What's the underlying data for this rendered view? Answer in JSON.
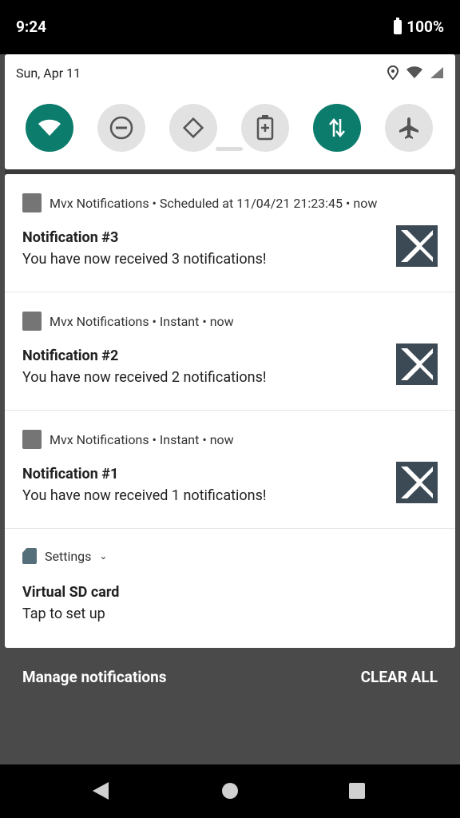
{
  "status_bar": {
    "time": "9:24",
    "battery": "100%"
  },
  "quick_settings": {
    "date": "Sun, Apr 11",
    "tiles": [
      {
        "name": "wifi",
        "active": true
      },
      {
        "name": "do-not-disturb",
        "active": false
      },
      {
        "name": "auto-rotate",
        "active": false
      },
      {
        "name": "battery-saver",
        "active": false
      },
      {
        "name": "mobile-data",
        "active": true
      },
      {
        "name": "airplane-mode",
        "active": false
      }
    ]
  },
  "notifications": [
    {
      "app": "Mvx Notifications",
      "meta": " • Scheduled at 11/04/21 21:23:45 • now",
      "title": "Notification #3",
      "text": "You have now received 3 notifications!"
    },
    {
      "app": "Mvx Notifications",
      "meta": " • Instant • now",
      "title": "Notification #2",
      "text": "You have now received 2 notifications!"
    },
    {
      "app": "Mvx Notifications",
      "meta": " • Instant • now",
      "title": "Notification #1",
      "text": "You have now received 1 notifications!"
    }
  ],
  "settings_notification": {
    "app": "Settings",
    "title": "Virtual SD card",
    "text": "Tap to set up"
  },
  "footer": {
    "manage": "Manage notifications",
    "clear": "CLEAR ALL"
  },
  "colors": {
    "accent": "#0c7c6c",
    "tile_inactive": "#e2e2e2",
    "icon_gray": "#757575"
  }
}
